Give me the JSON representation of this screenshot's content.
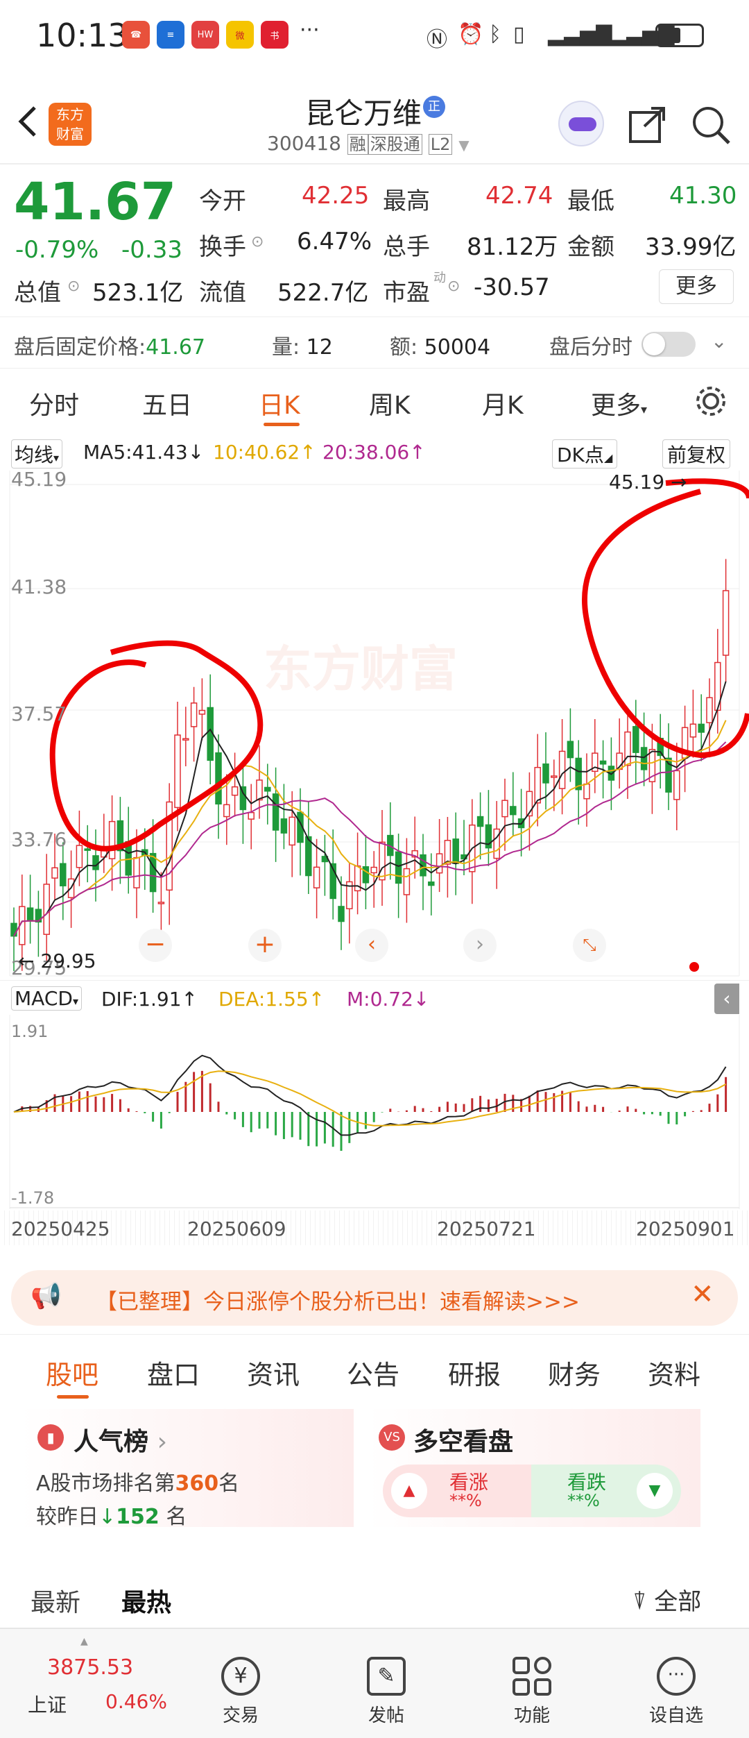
{
  "status": {
    "time": "10:13",
    "more": "···"
  },
  "header": {
    "stock_name": "昆仑万维",
    "badge": "正",
    "code": "300418",
    "tags": [
      "融",
      "深股通",
      "L2"
    ],
    "logo_line1": "东方",
    "logo_line2": "财富"
  },
  "quote": {
    "price": "41.67",
    "change_pct": "-0.79%",
    "change": "-0.33",
    "open_label": "今开",
    "open": "42.25",
    "high_label": "最高",
    "high": "42.74",
    "low_label": "最低",
    "low": "41.30",
    "turnover_label": "换手",
    "turnover": "6.47%",
    "volume_label": "总手",
    "volume": "81.12万",
    "amount_label": "金额",
    "amount": "33.99亿",
    "mktcap_label": "总值",
    "mktcap": "523.1亿",
    "float_label": "流值",
    "float": "522.7亿",
    "pe_label": "市盈",
    "pe_sup": "动",
    "pe": "-30.57",
    "more_button": "更多"
  },
  "afterhours": {
    "price_label": "盘后固定价格:",
    "price": "41.67",
    "vol_label": "量:",
    "vol": "12",
    "amt_label": "额:",
    "amt": "50004",
    "switch_label": "盘后分时"
  },
  "tabs": [
    "分时",
    "五日",
    "日K",
    "周K",
    "月K",
    "更多"
  ],
  "chart_toolbar": {
    "ma_select": "均线",
    "ma5": "MA5:41.43↓",
    "ma10": "10:40.62↑",
    "ma20": "20:38.06↑",
    "dk": "DK点",
    "adjust": "前复权"
  },
  "kline": {
    "y_ticks": [
      "45.19",
      "41.38",
      "37.57",
      "33.76",
      "29.75"
    ],
    "high_mark": "45.19",
    "low_mark": "29.95",
    "watermark": "东方财富"
  },
  "macd": {
    "select": "MACD",
    "dif": "DIF:1.91↑",
    "dea": "DEA:1.55↑",
    "m": "M:0.72↓",
    "y_top": "1.91",
    "y_bottom": "-1.78"
  },
  "dates": [
    "20250425",
    "20250609",
    "20250721",
    "20250901"
  ],
  "banner": {
    "text": "【已整理】今日涨停个股分析已出！速看解读>>>"
  },
  "sections": [
    "股吧",
    "盘口",
    "资讯",
    "公告",
    "研报",
    "财务",
    "资料"
  ],
  "popularity": {
    "title": "人气榜",
    "rank_prefix": "A股市场排名第",
    "rank": "360",
    "rank_suffix": "名",
    "change_prefix": "较昨日",
    "change": "152",
    "change_suffix": "名"
  },
  "bullbear": {
    "title": "多空看盘",
    "bull": "看涨",
    "bull_pct": "**%",
    "bear": "看跌",
    "bear_pct": "**%"
  },
  "feed": {
    "latest": "最新",
    "hottest": "最热",
    "filter": "全部"
  },
  "bottom_nav": {
    "index_value": "3875.53",
    "index_name": "上证",
    "index_pct": "0.46%",
    "items": [
      "交易",
      "发帖",
      "功能",
      "设自选"
    ]
  }
}
